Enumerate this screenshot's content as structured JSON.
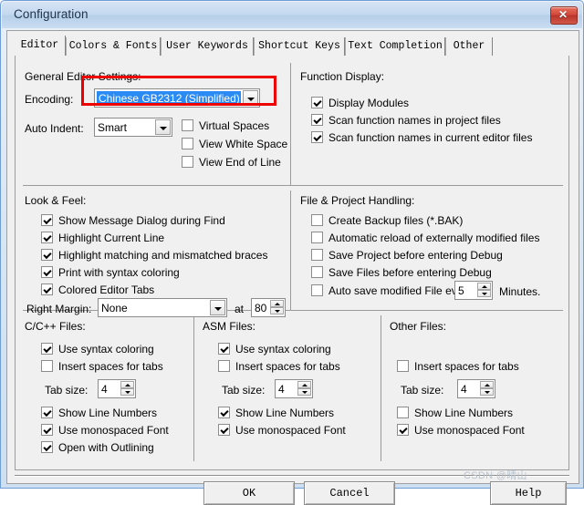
{
  "window": {
    "title": "Configuration",
    "close_label": "✕"
  },
  "tabs": [
    {
      "label": "Editor",
      "selected": true
    },
    {
      "label": "Colors & Fonts",
      "selected": false
    },
    {
      "label": "User Keywords",
      "selected": false
    },
    {
      "label": "Shortcut Keys",
      "selected": false
    },
    {
      "label": "Text Completion",
      "selected": false
    },
    {
      "label": "Other",
      "selected": false
    }
  ],
  "general_editor_settings": {
    "title": "General Editor Settings:",
    "encoding_label": "Encoding:",
    "encoding_value": "Chinese GB2312 (Simplified)",
    "auto_indent_label": "Auto Indent:",
    "auto_indent_value": "Smart",
    "checkboxes": [
      {
        "label": "Virtual Spaces",
        "checked": false
      },
      {
        "label": "View White Space",
        "checked": false
      },
      {
        "label": "View End of Line",
        "checked": false
      }
    ]
  },
  "function_display": {
    "title": "Function Display:",
    "checkboxes": [
      {
        "label": "Display Modules",
        "checked": true
      },
      {
        "label": "Scan function names in project files",
        "checked": true
      },
      {
        "label": "Scan function names in current editor files",
        "checked": true
      }
    ]
  },
  "look_and_feel": {
    "title": "Look & Feel:",
    "checkboxes": [
      {
        "label": "Show Message Dialog during Find",
        "checked": true
      },
      {
        "label": "Highlight Current Line",
        "checked": true
      },
      {
        "label": "Highlight matching and mismatched braces",
        "checked": true
      },
      {
        "label": "Print with syntax coloring",
        "checked": true
      },
      {
        "label": "Colored Editor Tabs",
        "checked": true
      }
    ],
    "right_margin_label": "Right Margin:",
    "right_margin_value": "None",
    "at_label": "at",
    "at_value": "80"
  },
  "file_project_handling": {
    "title": "File & Project Handling:",
    "checkboxes": [
      {
        "label": "Create Backup files (*.BAK)",
        "checked": false
      },
      {
        "label": "Automatic reload of externally modified files",
        "checked": false
      },
      {
        "label": "Save Project before entering Debug",
        "checked": false
      },
      {
        "label": "Save Files before entering Debug",
        "checked": false
      },
      {
        "label": "Auto save modified File every",
        "checked": false
      }
    ],
    "autosave_value": "5",
    "minutes_label": "Minutes."
  },
  "c_files": {
    "title": "C/C++ Files:",
    "checkboxes": [
      {
        "label": "Use syntax coloring",
        "checked": true
      },
      {
        "label": "Insert spaces for tabs",
        "checked": false
      }
    ],
    "tab_size_label": "Tab size:",
    "tab_size_value": "4",
    "checkboxes2": [
      {
        "label": "Show Line Numbers",
        "checked": true
      },
      {
        "label": "Use monospaced Font",
        "checked": true
      },
      {
        "label": "Open with Outlining",
        "checked": true
      }
    ]
  },
  "asm_files": {
    "title": "ASM Files:",
    "checkboxes": [
      {
        "label": "Use syntax coloring",
        "checked": true
      },
      {
        "label": "Insert spaces for tabs",
        "checked": false
      }
    ],
    "tab_size_label": "Tab size:",
    "tab_size_value": "4",
    "checkboxes2": [
      {
        "label": "Show Line Numbers",
        "checked": true
      },
      {
        "label": "Use monospaced Font",
        "checked": true
      }
    ]
  },
  "other_files": {
    "title": "Other Files:",
    "checkboxes": [
      {
        "label": "Insert spaces for tabs",
        "checked": false
      }
    ],
    "tab_size_label": "Tab size:",
    "tab_size_value": "4",
    "checkboxes2": [
      {
        "label": "Show Line Numbers",
        "checked": false
      },
      {
        "label": "Use monospaced Font",
        "checked": true
      }
    ]
  },
  "buttons": {
    "ok": "OK",
    "cancel": "Cancel",
    "help": "Help"
  },
  "watermark": "CSDN @晴山",
  "colors": {
    "highlight_rect": "#ee0000",
    "selection_blue": "#2b8bf4",
    "dialog_face": "#f0f0f0"
  }
}
